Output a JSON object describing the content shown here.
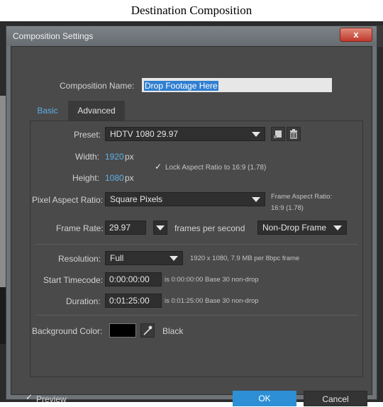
{
  "caption": "Destination Composition",
  "window": {
    "title": "Composition Settings",
    "close_glyph": "x"
  },
  "composition_name": {
    "label": "Composition Name:",
    "value": "Drop Footage Here"
  },
  "tabs": [
    {
      "label": "Basic",
      "active": true
    },
    {
      "label": "Advanced",
      "active": false
    }
  ],
  "preset": {
    "label": "Preset:",
    "value": "HDTV 1080 29.97"
  },
  "width": {
    "label": "Width:",
    "value": "1920",
    "unit": "px"
  },
  "height": {
    "label": "Height:",
    "value": "1080",
    "unit": "px"
  },
  "lock_aspect": {
    "label": "Lock Aspect Ratio to 16:9 (1.78)",
    "checked": true
  },
  "pixel_aspect": {
    "label": "Pixel Aspect Ratio:",
    "value": "Square Pixels"
  },
  "frame_aspect": {
    "label": "Frame Aspect Ratio:",
    "value": "16:9 (1.78)"
  },
  "frame_rate": {
    "label": "Frame Rate:",
    "value": "29.97",
    "suffix": "frames per second",
    "drop_mode": "Non-Drop Frame"
  },
  "resolution": {
    "label": "Resolution:",
    "value": "Full",
    "info": "1920 x 1080, 7.9 MB per 8bpc frame"
  },
  "start_timecode": {
    "label": "Start Timecode:",
    "value": "0:00:00:00",
    "info": "is 0:00:00:00  Base 30  non-drop"
  },
  "duration": {
    "label": "Duration:",
    "value": "0:01:25:00",
    "info": "is 0:01:25:00  Base 30  non-drop"
  },
  "background_color": {
    "label": "Background Color:",
    "name": "Black",
    "hex": "#000000"
  },
  "preview": {
    "label": "Preview",
    "checked": true
  },
  "buttons": {
    "ok": "OK",
    "cancel": "Cancel"
  },
  "icons": [
    "save-preset-icon",
    "trash-icon",
    "eyedropper-icon",
    "checkbox-icon"
  ]
}
